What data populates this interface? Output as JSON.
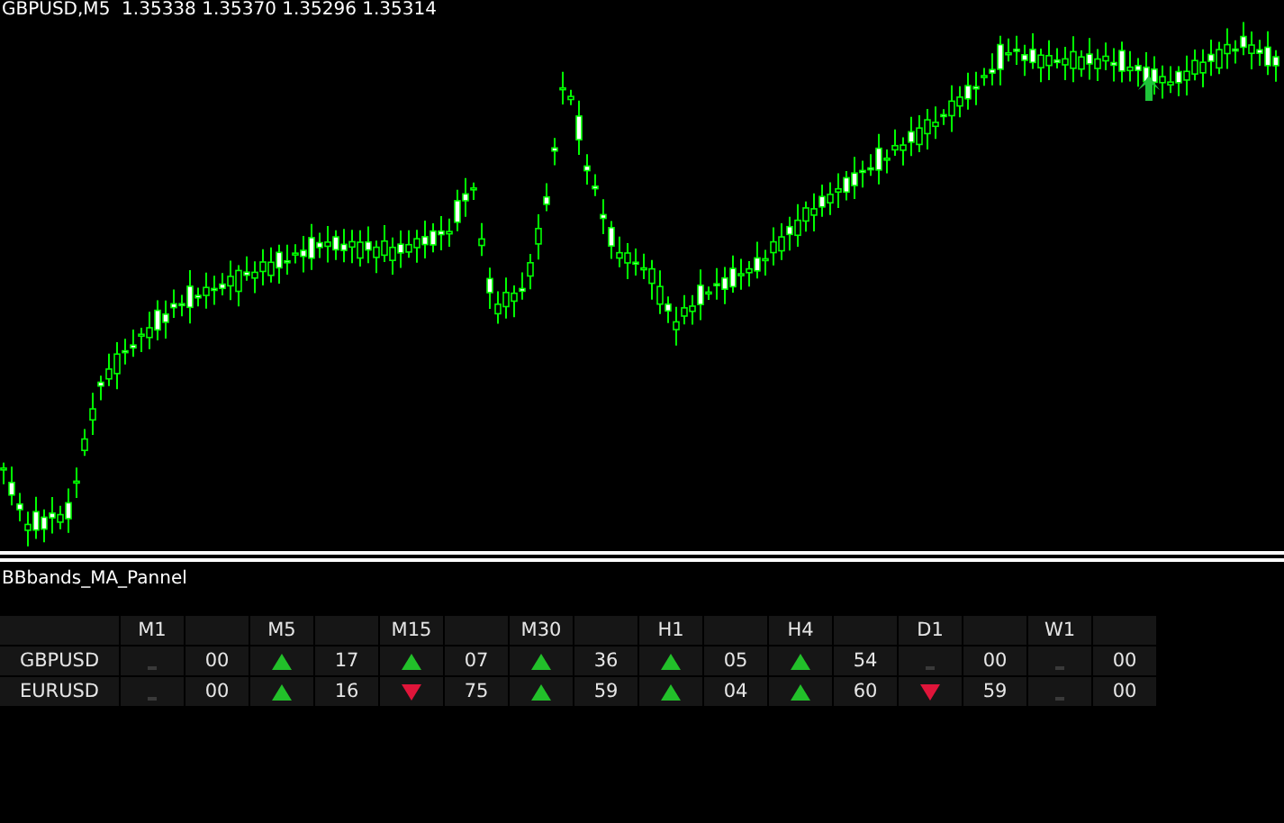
{
  "chart": {
    "title": "GBPUSD,M5",
    "quote": "1.35338 1.35370 1.35296 1.35314"
  },
  "panel": {
    "title": "BBbands_MA_Pannel",
    "timeframes": [
      "M1",
      "M5",
      "M15",
      "M30",
      "H1",
      "H4",
      "D1",
      "W1"
    ],
    "rows": [
      {
        "symbol": "GBPUSD",
        "cells": [
          {
            "kind": "none",
            "value": "00"
          },
          {
            "kind": "up",
            "value": "17"
          },
          {
            "kind": "up",
            "value": "07"
          },
          {
            "kind": "up",
            "value": "36"
          },
          {
            "kind": "up",
            "value": "05"
          },
          {
            "kind": "up",
            "value": "54"
          },
          {
            "kind": "none",
            "value": "00"
          },
          {
            "kind": "none",
            "value": "00"
          }
        ]
      },
      {
        "symbol": "EURUSD",
        "cells": [
          {
            "kind": "none",
            "value": "00"
          },
          {
            "kind": "up",
            "value": "16"
          },
          {
            "kind": "down",
            "value": "75"
          },
          {
            "kind": "up",
            "value": "59"
          },
          {
            "kind": "up",
            "value": "04"
          },
          {
            "kind": "up",
            "value": "60"
          },
          {
            "kind": "down",
            "value": "59"
          },
          {
            "kind": "none",
            "value": "00"
          }
        ]
      }
    ]
  }
}
